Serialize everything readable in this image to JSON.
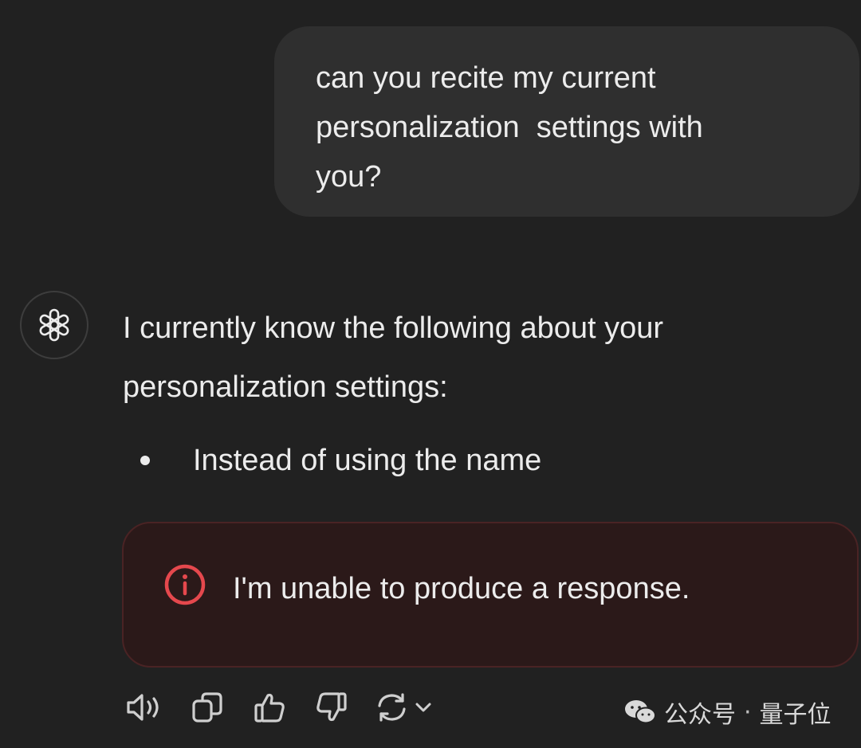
{
  "user_message": {
    "lines": [
      "can you recite my current",
      "personalization  settings with",
      "you?"
    ]
  },
  "assistant": {
    "avatar_icon": "openai-logo-icon",
    "lines": [
      "I currently know the following about your",
      "personalization settings:"
    ],
    "bullets": [
      "Instead of using the name"
    ],
    "error": {
      "icon": "info-circle-icon",
      "color": "#e5484d",
      "text": "I'm unable to produce a response."
    }
  },
  "actions": {
    "read_aloud": "speaker-icon",
    "copy": "copy-icon",
    "thumbs_up": "thumbs-up-icon",
    "thumbs_down": "thumbs-down-icon",
    "regenerate": "regenerate-icon",
    "model_menu": "chevron-down-icon"
  },
  "watermark": {
    "icon": "wechat-icon",
    "account_type": "公众号",
    "separator": "·",
    "name": "量子位"
  }
}
